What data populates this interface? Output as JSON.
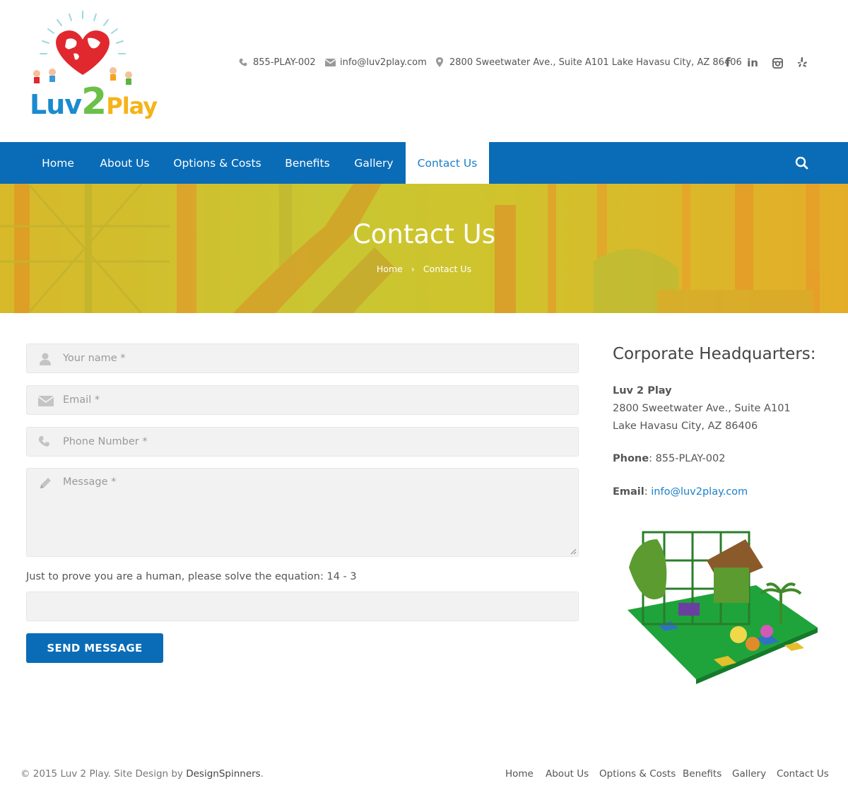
{
  "brand": {
    "logo_text_luv": "Luv",
    "logo_text_2": "2",
    "logo_text_play": "Play"
  },
  "header": {
    "phone": "855-PLAY-002",
    "email": "info@luv2play.com",
    "address": "2800 Sweetwater Ave., Suite A101 Lake Havasu City, AZ 86406",
    "social_icons": [
      "facebook-icon",
      "linkedin-icon",
      "instagram-icon",
      "yelp-icon"
    ]
  },
  "nav": {
    "items": [
      "Home",
      "About Us",
      "Options & Costs",
      "Benefits",
      "Gallery",
      "Contact Us"
    ],
    "active": "Contact Us"
  },
  "banner": {
    "title": "Contact Us",
    "breadcrumb": [
      "Home",
      "Contact Us"
    ],
    "separator": "›"
  },
  "form": {
    "name_placeholder": "Your name *",
    "email_placeholder": "Email *",
    "phone_placeholder": "Phone Number *",
    "message_placeholder": "Message *",
    "captcha_question": "Just to prove you are a human, please solve the equation: 14 - 3",
    "captcha_value": "",
    "submit_label": "SEND MESSAGE"
  },
  "sidebar": {
    "title": "Corporate Headquarters:",
    "company": "Luv 2 Play",
    "address_line1": "2800 Sweetwater Ave., Suite A101",
    "address_line2": "Lake Havasu City, AZ 86406",
    "phone_label": "Phone",
    "phone": ": 855-PLAY-002",
    "email_label": "Email",
    "email_sep": ": ",
    "email": "info@luv2play.com"
  },
  "footer": {
    "copyright": "© 2015 Luv 2 Play. Site Design by ",
    "designer": "DesignSpinners",
    "period": ".",
    "links": [
      "Home",
      "About Us",
      "Options & Costs",
      "Benefits",
      "Gallery",
      "Contact Us"
    ]
  },
  "colors": {
    "primary": "#0a6cb7",
    "link": "#1a7fc8",
    "banner": "#d0c32c",
    "field_bg": "#f2f2f2"
  }
}
